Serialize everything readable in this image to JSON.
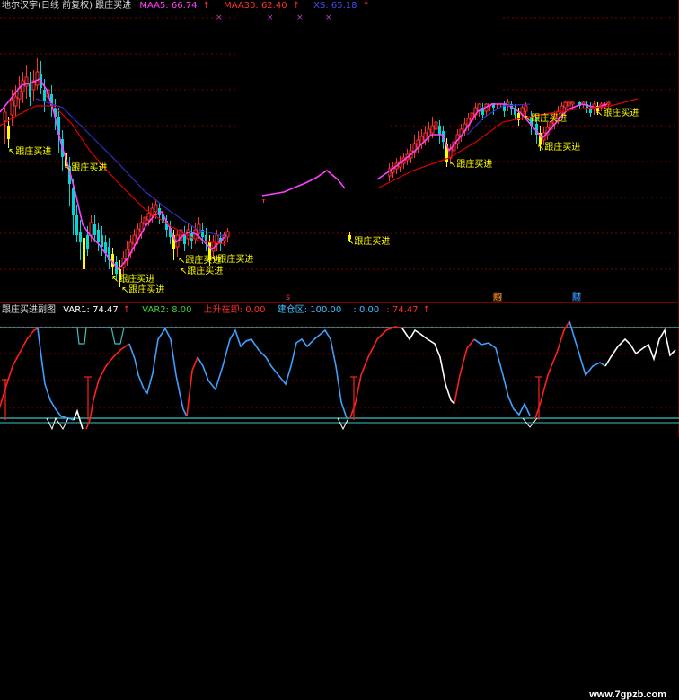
{
  "main_header": {
    "title": "地尔汉宇(日线 前复权) 跟庄买进",
    "maa5_label": "MAA5: 66.74",
    "maa30_label": "MAA30: 62.40",
    "xs_label": "XS: 65.18",
    "arrow": "↑"
  },
  "signal_text": "跟庄买进",
  "signal_arrow": "↖",
  "event_markers": {
    "s_marker": "s",
    "gou_marker": "购",
    "cai_marker": "财"
  },
  "sub_header": {
    "title": "跟庄买进副图",
    "var1_label": "VAR1: 74.47",
    "var2_label": "VAR2: 8.00",
    "uptrend_label": "上升在即: 0.00",
    "jiancang_label": "建仓区: 100.00",
    "val_zero": ": 0.00",
    "val_last": ": 74.47",
    "arrow": "↑"
  },
  "watermark": "www.7gpzb.com",
  "colors": {
    "background": "#000000",
    "up_candle": "#ff3030",
    "down_candle": "#00d8d8",
    "signal_candle": "#ffff00",
    "maa5": "#ff40ff",
    "maa30": "#e00000",
    "xs": "#3030c0",
    "grid": "#800000",
    "var1_up": "#ff2020",
    "var1_down": "#3fa0ff",
    "var1_neutral": "#ffffff",
    "level_line": "#40c0c0"
  },
  "chart_data": {
    "type": "candlestick",
    "note_series": [
      "MAA5",
      "MAA30",
      "XS"
    ],
    "last_values": {
      "MAA5": 66.74,
      "MAA30": 62.4,
      "XS": 65.18
    },
    "subchart": {
      "type": "line",
      "series": [
        {
          "name": "VAR1",
          "last": 74.47
        },
        {
          "name": "VAR2",
          "last": 8.0
        },
        {
          "name": "上升在即",
          "last": 0.0
        },
        {
          "name": "建仓区",
          "last": 100.0
        }
      ]
    }
  }
}
